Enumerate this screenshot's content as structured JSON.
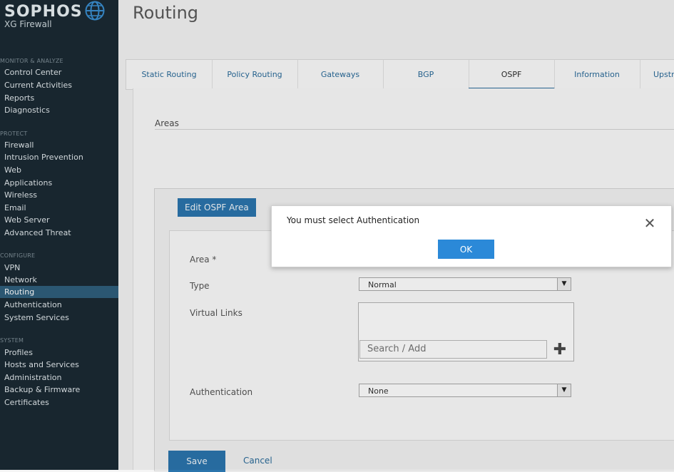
{
  "brand": {
    "name": "SOPHOS",
    "product": "XG Firewall",
    "globe_icon": "globe-icon"
  },
  "sidebar": {
    "sections": [
      {
        "title": "MONITOR & ANALYZE",
        "items": [
          "Control Center",
          "Current Activities",
          "Reports",
          "Diagnostics"
        ]
      },
      {
        "title": "PROTECT",
        "items": [
          "Firewall",
          "Intrusion Prevention",
          "Web",
          "Applications",
          "Wireless",
          "Email",
          "Web Server",
          "Advanced Threat"
        ]
      },
      {
        "title": "CONFIGURE",
        "items": [
          "VPN",
          "Network",
          "Routing",
          "Authentication",
          "System Services"
        ]
      },
      {
        "title": "SYSTEM",
        "items": [
          "Profiles",
          "Hosts and Services",
          "Administration",
          "Backup & Firmware",
          "Certificates"
        ]
      }
    ],
    "active_item": "Routing"
  },
  "page": {
    "title": "Routing"
  },
  "tabs": [
    "Static Routing",
    "Policy Routing",
    "Gateways",
    "BGP",
    "OSPF",
    "Information",
    "Upstr"
  ],
  "content": {
    "areas_label": "Areas",
    "panel_title": "Edit OSPF Area",
    "fields": {
      "area_label": "Area *",
      "type_label": "Type",
      "type_value": "Normal",
      "virtual_links_label": "Virtual Links",
      "search_placeholder": "Search / Add",
      "auth_label": "Authentication",
      "auth_value": "None"
    },
    "save_label": "Save",
    "cancel_label": "Cancel"
  },
  "dialog": {
    "message": "You must select Authentication",
    "ok_label": "OK",
    "close_glyph": "✕"
  },
  "colors": {
    "sidebar_bg": "#1b2a33",
    "accent": "#2b75ad",
    "ok_button": "#2b89d8"
  }
}
